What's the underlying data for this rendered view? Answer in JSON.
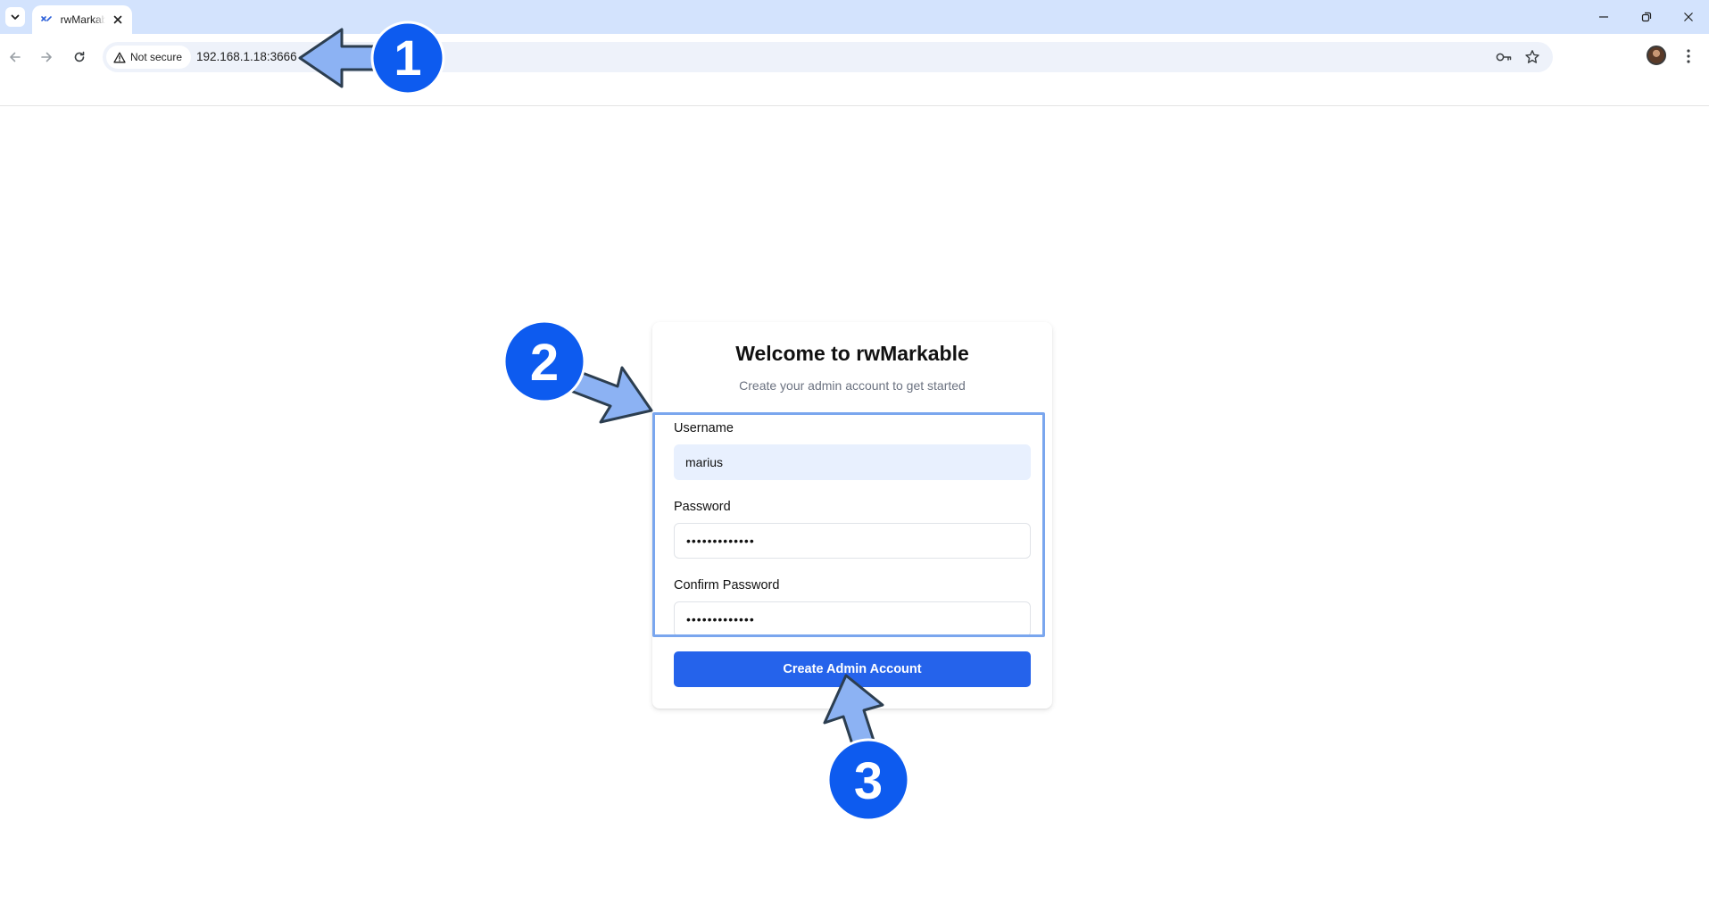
{
  "browser": {
    "tab_title": "rwMarkable",
    "security_label": "Not secure",
    "url": "192.168.1.18:3666"
  },
  "card": {
    "title": "Welcome to rwMarkable",
    "subtitle": "Create your admin account to get started",
    "username_label": "Username",
    "username_value": "marius",
    "password_label": "Password",
    "password_value": "•••••••••••••",
    "confirm_label": "Confirm Password",
    "confirm_value": "•••••••••••••",
    "submit_label": "Create Admin Account"
  },
  "annotations": {
    "step1": "1",
    "step2": "2",
    "step3": "3",
    "badge_color": "#0d5bef",
    "arrow_color": "#8cb2f3"
  }
}
